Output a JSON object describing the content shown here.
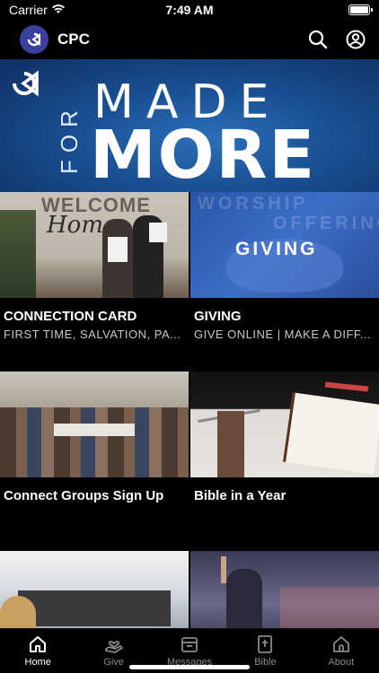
{
  "status_bar": {
    "carrier": "Carrier",
    "time": "7:49 AM"
  },
  "nav": {
    "title": "CPC"
  },
  "hero": {
    "line_for": "FOR",
    "line_made": "MADE",
    "line_more": "MORE"
  },
  "tiles": [
    {
      "title": "CONNECTION CARD",
      "subtitle": "FIRST TIME, SALVATION, PA...",
      "image_text_1": "WELCOME",
      "image_text_2": "Home"
    },
    {
      "title": "GIVING",
      "subtitle": "GIVE ONLINE | MAKE A DIFF...",
      "image_text_1": "GIVING",
      "image_text_2": "WORSHIP",
      "image_text_3": "OFFERING"
    },
    {
      "title": "Connect Groups Sign Up",
      "subtitle": ""
    },
    {
      "title": "Bible in a Year",
      "subtitle": ""
    },
    {
      "title": "",
      "subtitle": ""
    },
    {
      "title": "",
      "subtitle": ""
    }
  ],
  "tab_bar": {
    "items": [
      {
        "label": "Home",
        "icon": "home-icon",
        "active": true
      },
      {
        "label": "Give",
        "icon": "give-icon",
        "active": false
      },
      {
        "label": "Messages",
        "icon": "messages-icon",
        "active": false
      },
      {
        "label": "Bible",
        "icon": "bible-icon",
        "active": false
      },
      {
        "label": "About",
        "icon": "about-icon",
        "active": false
      }
    ]
  },
  "colors": {
    "accent": "#3b3f9e",
    "background": "#000000",
    "tab_inactive": "#8a8a8a"
  }
}
